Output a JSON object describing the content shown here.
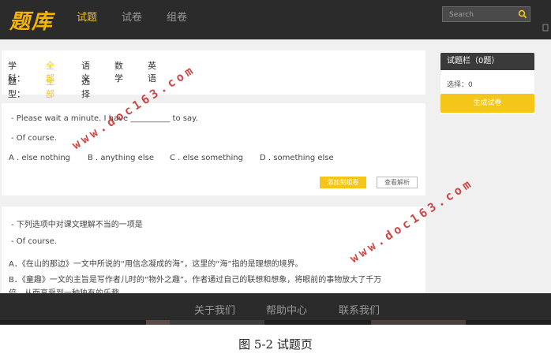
{
  "header": {
    "logo": "题库",
    "nav": [
      "试题",
      "试卷",
      "组卷"
    ],
    "search_placeholder": "Search"
  },
  "filters": {
    "subject_label": "学科：",
    "subject_options": [
      "全部",
      "语文",
      "数学",
      "英语"
    ],
    "type_label": "题型：",
    "type_options": [
      "全部",
      "选择"
    ]
  },
  "questions": [
    {
      "lines": [
        "- Please wait a minute. I have __________ to say.",
        "- Of course."
      ],
      "options": [
        "A . else nothing",
        "B . anything else",
        "C . else something",
        "D . something else"
      ],
      "add_button": "添加到组卷",
      "view_button": "查看解析"
    },
    {
      "lines": [
        "- 下列选项中对课文理解不当的一项是",
        "- Of course."
      ],
      "options": [
        "A．《在山的那边》一文中所说的“用信念凝成的海”，这里的“海”指的是理想的境界。",
        "B．《童趣》一文的主旨是写作者儿时的“物外之趣”。作者通过自己的联想和想象，将眼前的事物放大了千万",
        "倍，从而享受到一种独有的乐趣。"
      ]
    }
  ],
  "side_panel": {
    "title": "试题栏（0题）",
    "selected": "选择：0",
    "generate_button": "生成试卷"
  },
  "watermark": "www.doc163.com",
  "footer": {
    "links": [
      "关于我们",
      "帮助中心",
      "联系我们"
    ]
  },
  "caption": "图 5-2  试题页",
  "colors": {
    "accent": "#f5c518",
    "header_bg": "#2b2b2b",
    "watermark": "#c62828"
  }
}
